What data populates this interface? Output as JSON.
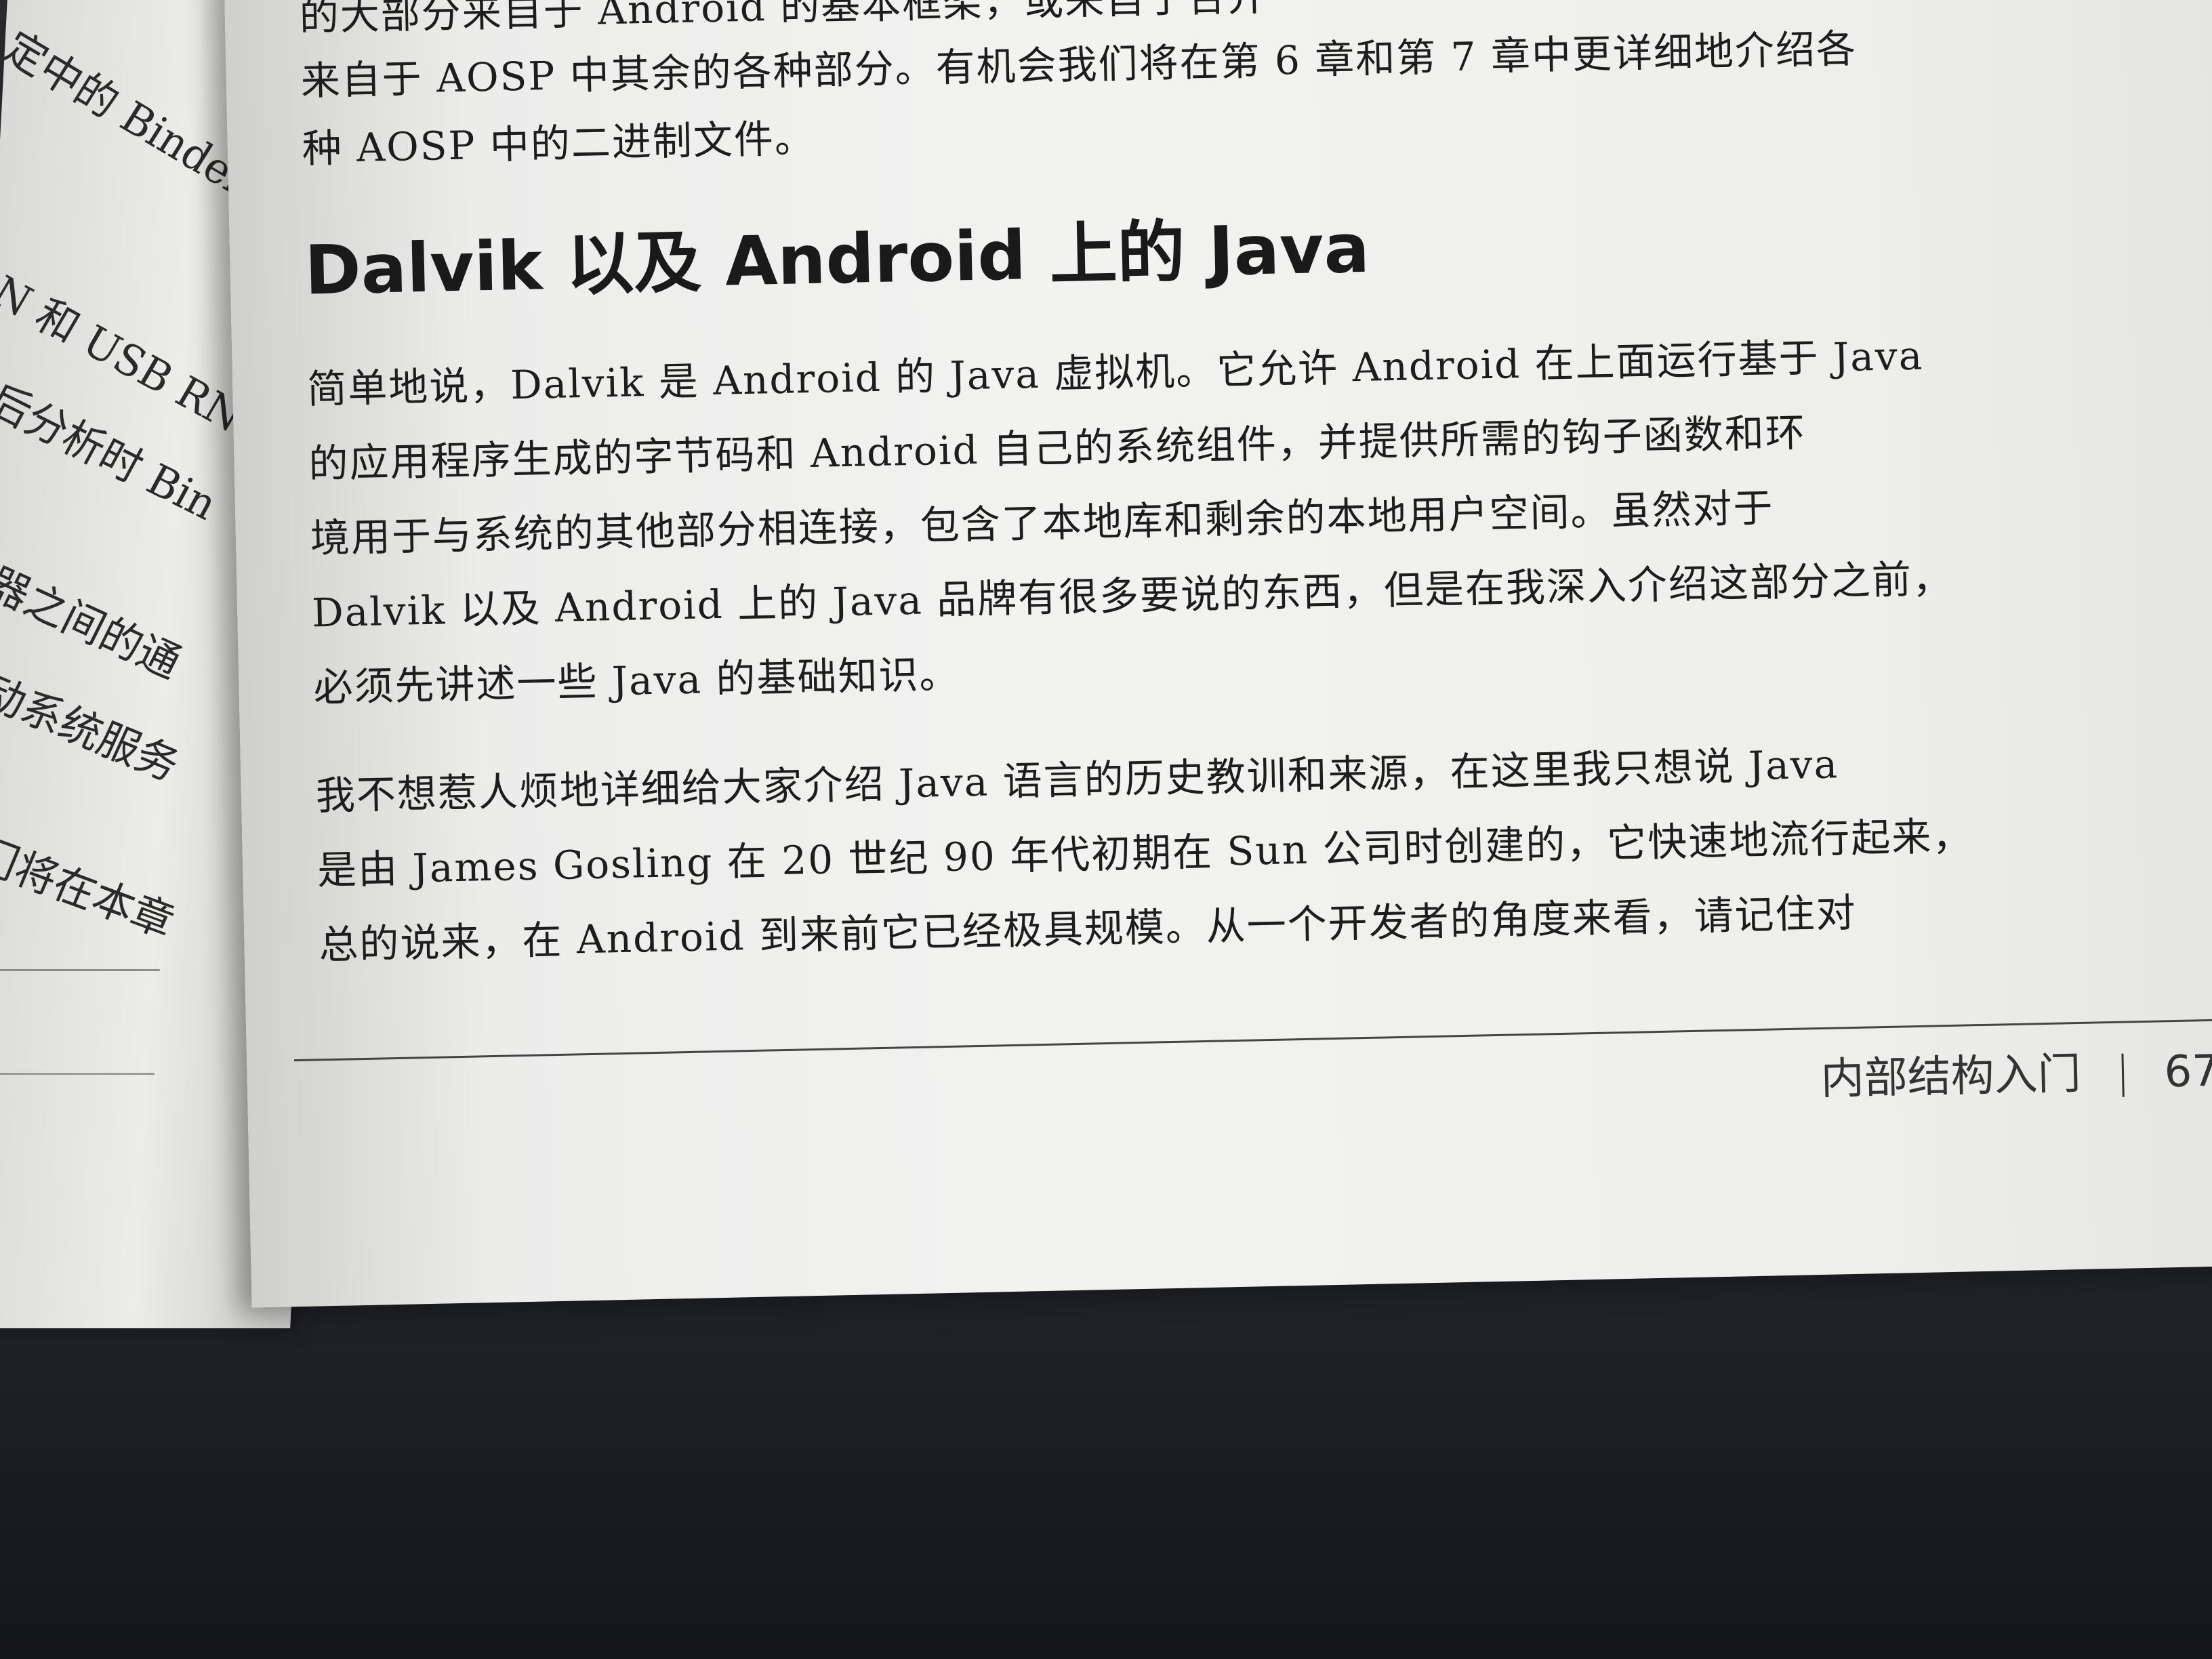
{
  "left_page": {
    "lines": [
      "定中的 Binder",
      "N 和 USB RN",
      "后分析时 Bin",
      "器之间的通",
      "动系统服务",
      "门将在本章"
    ]
  },
  "main_page": {
    "intro_lines": [
      "的大部分来自于 Android 的基本框架，或来自于合并",
      "来自于 AOSP 中其余的各种部分。有机会我们将在第 6 章和第 7 章中更详细地介绍各",
      "种 AOSP 中的二进制文件。"
    ],
    "heading": "Dalvik 以及 Android 上的 Java",
    "paragraph1": [
      "简单地说，Dalvik 是 Android 的 Java 虚拟机。它允许 Android 在上面运行基于 Java",
      "的应用程序生成的字节码和 Android 自己的系统组件，并提供所需的钩子函数和环",
      "境用于与系统的其他部分相连接，包含了本地库和剩余的本地用户空间。虽然对于",
      "Dalvik 以及 Android 上的 Java 品牌有很多要说的东西，但是在我深入介绍这部分之前，",
      "必须先讲述一些 Java 的基础知识。"
    ],
    "paragraph2": [
      "我不想惹人烦地详细给大家介绍 Java 语言的历史教训和来源，在这里我只想说 Java",
      "是由 James Gosling 在 20 世纪 90 年代初期在 Sun 公司时创建的，它快速地流行起来，",
      "总的说来，在 Android 到来前它已经极具规模。从一个开发者的角度来看，请记住对"
    ],
    "footer": {
      "chapter": "内部结构入门",
      "page_number": "67"
    }
  }
}
